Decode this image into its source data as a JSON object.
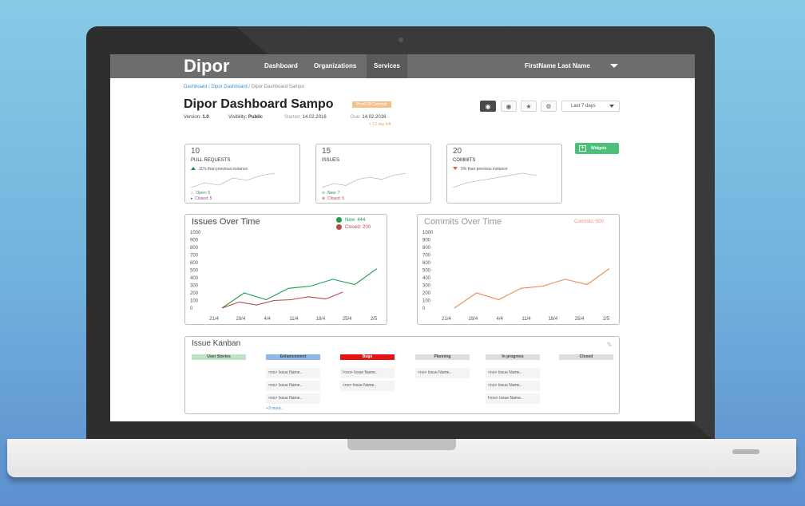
{
  "app": {
    "logo": "Dipor",
    "nav": [
      "Dashboard",
      "Organizations",
      "Services"
    ],
    "active_nav": "Services",
    "user_name": "FirstName Last Name"
  },
  "breadcrumb": {
    "items": [
      "Dashboard",
      "Dipor Dashboard",
      "Dipor Dashboard Sampo"
    ],
    "sep": " / "
  },
  "page": {
    "title": "Dipor Dashboard Sampo",
    "badge": "Proof Of Concept",
    "version_label": "Version:",
    "version": "1.0",
    "visibility_label": "Visibility:",
    "visibility": "Public",
    "started_label": "Started:",
    "started": "14.02.2016",
    "due_label": "Due:",
    "due": "14.02.2016",
    "days_left": "+ 13 day left",
    "range": "Last 7 days",
    "widgets_button": "Widgets"
  },
  "icons": {
    "github": "github-icon",
    "watch": "eye-icon",
    "star": "star-icon",
    "settings": "gear-icon",
    "edit": "edit-icon"
  },
  "stats": [
    {
      "value": "10",
      "label": "PULL REQUESTS",
      "delta": "11% than previous instance",
      "trend": "up",
      "open": "Open: 5",
      "closed": "Closed: 5",
      "spark": [
        3,
        5,
        4,
        7,
        6,
        8,
        9
      ]
    },
    {
      "value": "15",
      "label": "ISSUES",
      "delta": "",
      "trend": "",
      "open": "New: 7",
      "closed": "Closed: 5",
      "spark": [
        2,
        4,
        3,
        6,
        7,
        6,
        8,
        9
      ]
    },
    {
      "value": "20",
      "label": "COMMITS",
      "delta": "5% than previous instance",
      "trend": "down",
      "open": "",
      "closed": "",
      "spark": [
        3,
        5,
        6,
        7,
        8,
        9,
        8
      ]
    }
  ],
  "colors": {
    "green": "#1e9e4a",
    "red": "#b84a44",
    "orange": "#e98a4a",
    "topbar": "#6d6d6d"
  },
  "issues_chart": {
    "title": "Issues Over Time",
    "legend_new": "New: 444",
    "legend_closed": "Closed: 200",
    "chart_data": {
      "type": "line",
      "x": [
        "21/4",
        "28/4",
        "4/4",
        "11/4",
        "18/4",
        "25/4",
        "2/5"
      ],
      "y_ticks": [
        0,
        100,
        200,
        300,
        400,
        500,
        600,
        700,
        800,
        900,
        1000
      ],
      "ylim": [
        0,
        1000
      ],
      "series": [
        {
          "name": "New",
          "values": [
            0,
            200,
            110,
            260,
            290,
            380,
            310,
            520
          ]
        },
        {
          "name": "Closed",
          "values": [
            0,
            80,
            40,
            100,
            110,
            150,
            120,
            210
          ]
        }
      ]
    }
  },
  "commits_chart": {
    "title": "Commits Over Time",
    "legend": "Commits: 500",
    "chart_data": {
      "type": "line",
      "x": [
        "21/4",
        "28/4",
        "4/4",
        "11/4",
        "18/4",
        "25/4",
        "2/5"
      ],
      "y_ticks": [
        0,
        100,
        200,
        300,
        400,
        500,
        600,
        700,
        800,
        900,
        1000
      ],
      "ylim": [
        0,
        1000
      ],
      "series": [
        {
          "name": "Commits",
          "values": [
            0,
            200,
            110,
            260,
            290,
            380,
            310,
            520
          ]
        }
      ]
    }
  },
  "kanban": {
    "title": "Issue Kanban",
    "columns": [
      {
        "name": "User Stories",
        "color": "#bfe3c8",
        "items": []
      },
      {
        "name": "Enhancement",
        "color": "#8fb8e6",
        "items": [
          "<no> Issue Name..",
          "<no> Issue Name..",
          "<no> Issue Name.."
        ],
        "more": "+3 more..."
      },
      {
        "name": "Bugs",
        "color": "#e21414",
        "items": [
          "I<no> Issue Name..",
          "<no> Issue Name.."
        ]
      },
      {
        "name": "Planning",
        "color": "#dedede",
        "items": [
          "<no> Issue Name.."
        ]
      },
      {
        "name": "In progress",
        "color": "#dedede",
        "items": [
          "<no> Issue Name..",
          "<no> Issue Name..",
          "I<no> Issue Name.."
        ]
      },
      {
        "name": "Closed",
        "color": "#dedede",
        "items": []
      }
    ]
  }
}
